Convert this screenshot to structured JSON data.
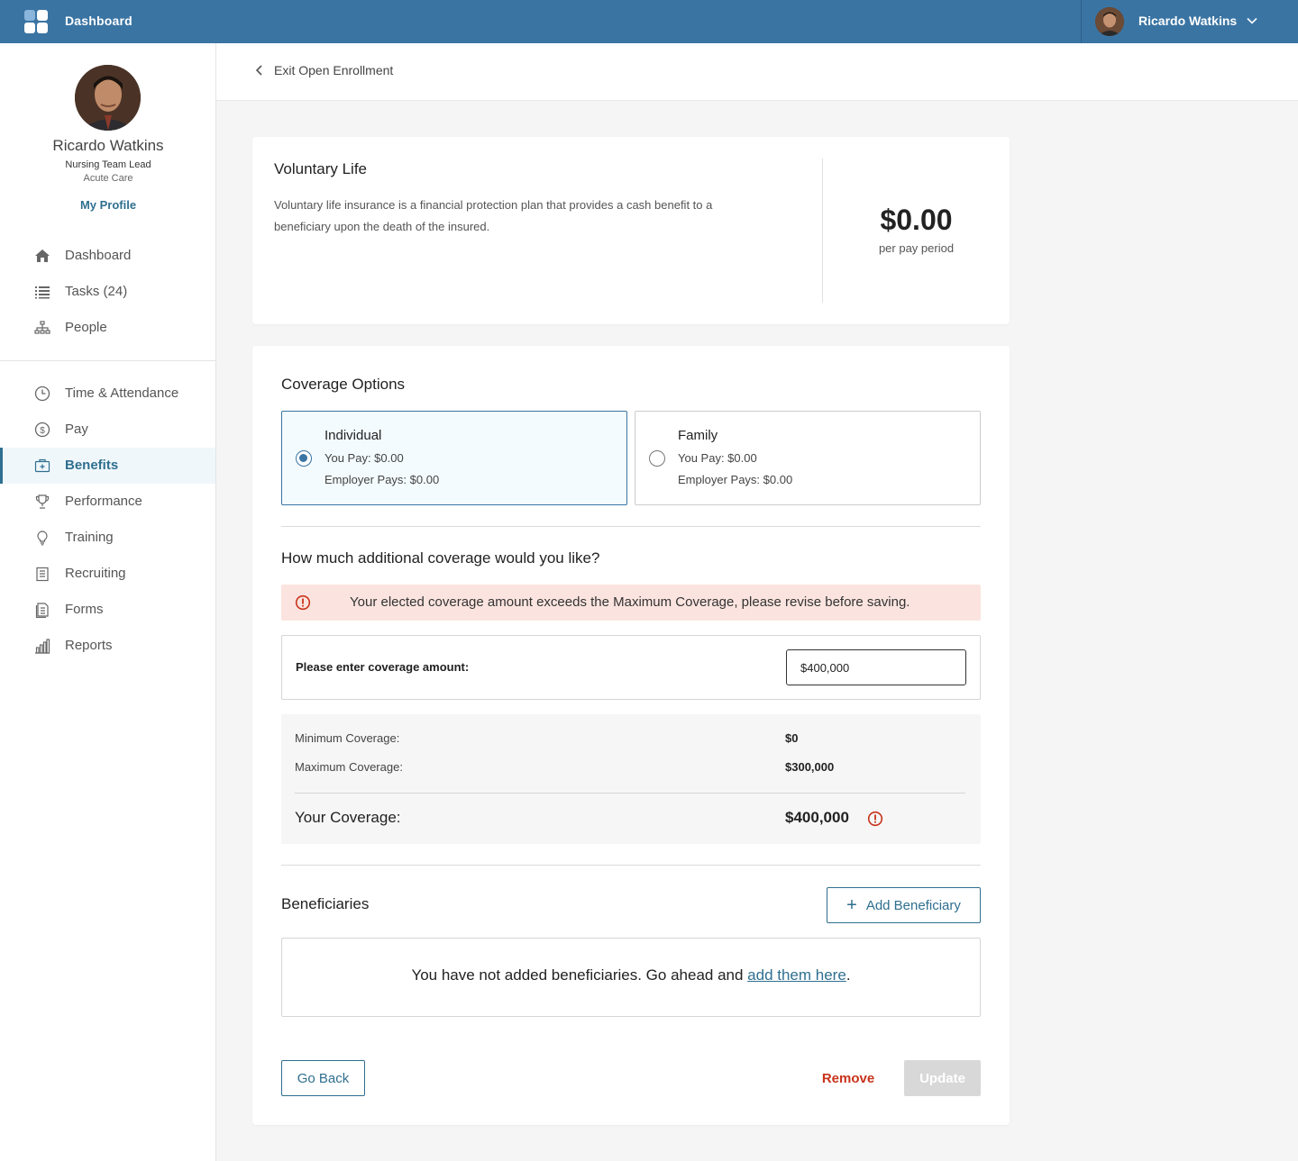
{
  "topbar": {
    "title": "Dashboard",
    "user_name": "Ricardo Watkins"
  },
  "profile": {
    "name": "Ricardo Watkins",
    "title": "Nursing Team Lead",
    "department": "Acute Care",
    "link": "My Profile"
  },
  "nav": {
    "primary": [
      {
        "label": "Dashboard",
        "icon": "home-icon"
      },
      {
        "label": "Tasks (24)",
        "icon": "list-icon"
      },
      {
        "label": "People",
        "icon": "org-chart-icon"
      }
    ],
    "secondary": [
      {
        "label": "Time & Attendance",
        "icon": "clock-icon"
      },
      {
        "label": "Pay",
        "icon": "dollar-icon"
      },
      {
        "label": "Benefits",
        "icon": "benefits-icon",
        "active": true
      },
      {
        "label": "Performance",
        "icon": "trophy-icon"
      },
      {
        "label": "Training",
        "icon": "lightbulb-icon"
      },
      {
        "label": "Recruiting",
        "icon": "clipboard-icon"
      },
      {
        "label": "Forms",
        "icon": "forms-icon"
      },
      {
        "label": "Reports",
        "icon": "bar-chart-icon"
      }
    ]
  },
  "subheader": {
    "back_label": "Exit Open Enrollment"
  },
  "plan": {
    "name": "Voluntary Life",
    "description": "Voluntary life insurance is a financial protection plan that provides a cash benefit to a beneficiary upon the death of the insured.",
    "price": "$0.00",
    "period": "per pay period"
  },
  "coverage": {
    "title": "Coverage Options",
    "options": [
      {
        "name": "Individual",
        "you_pay": "You Pay: $0.00",
        "employer_pays": "Employer Pays: $0.00",
        "selected": true
      },
      {
        "name": "Family",
        "you_pay": "You Pay: $0.00",
        "employer_pays": "Employer Pays: $0.00",
        "selected": false
      }
    ]
  },
  "additional": {
    "question": "How much additional coverage would you like?",
    "alert": "Your elected coverage amount exceeds the Maximum Coverage, please revise before saving.",
    "input_label": "Please enter coverage amount:",
    "input_value": "$400,000",
    "min_label": "Minimum Coverage:",
    "min_value": "$0",
    "max_label": "Maximum Coverage:",
    "max_value": "$300,000",
    "your_label": "Your Coverage:",
    "your_value": "$400,000"
  },
  "beneficiaries": {
    "title": "Beneficiaries",
    "add_button": "Add Beneficiary",
    "empty_text": "You have not added beneficiaries. Go ahead and ",
    "empty_link": "add them here",
    "empty_end": "."
  },
  "actions": {
    "back": "Go Back",
    "remove": "Remove",
    "update": "Update"
  },
  "colors": {
    "brand": "#3a74a3",
    "accent": "#2f6f8f",
    "error": "#c8331b",
    "alert_bg": "#fbe4df"
  }
}
